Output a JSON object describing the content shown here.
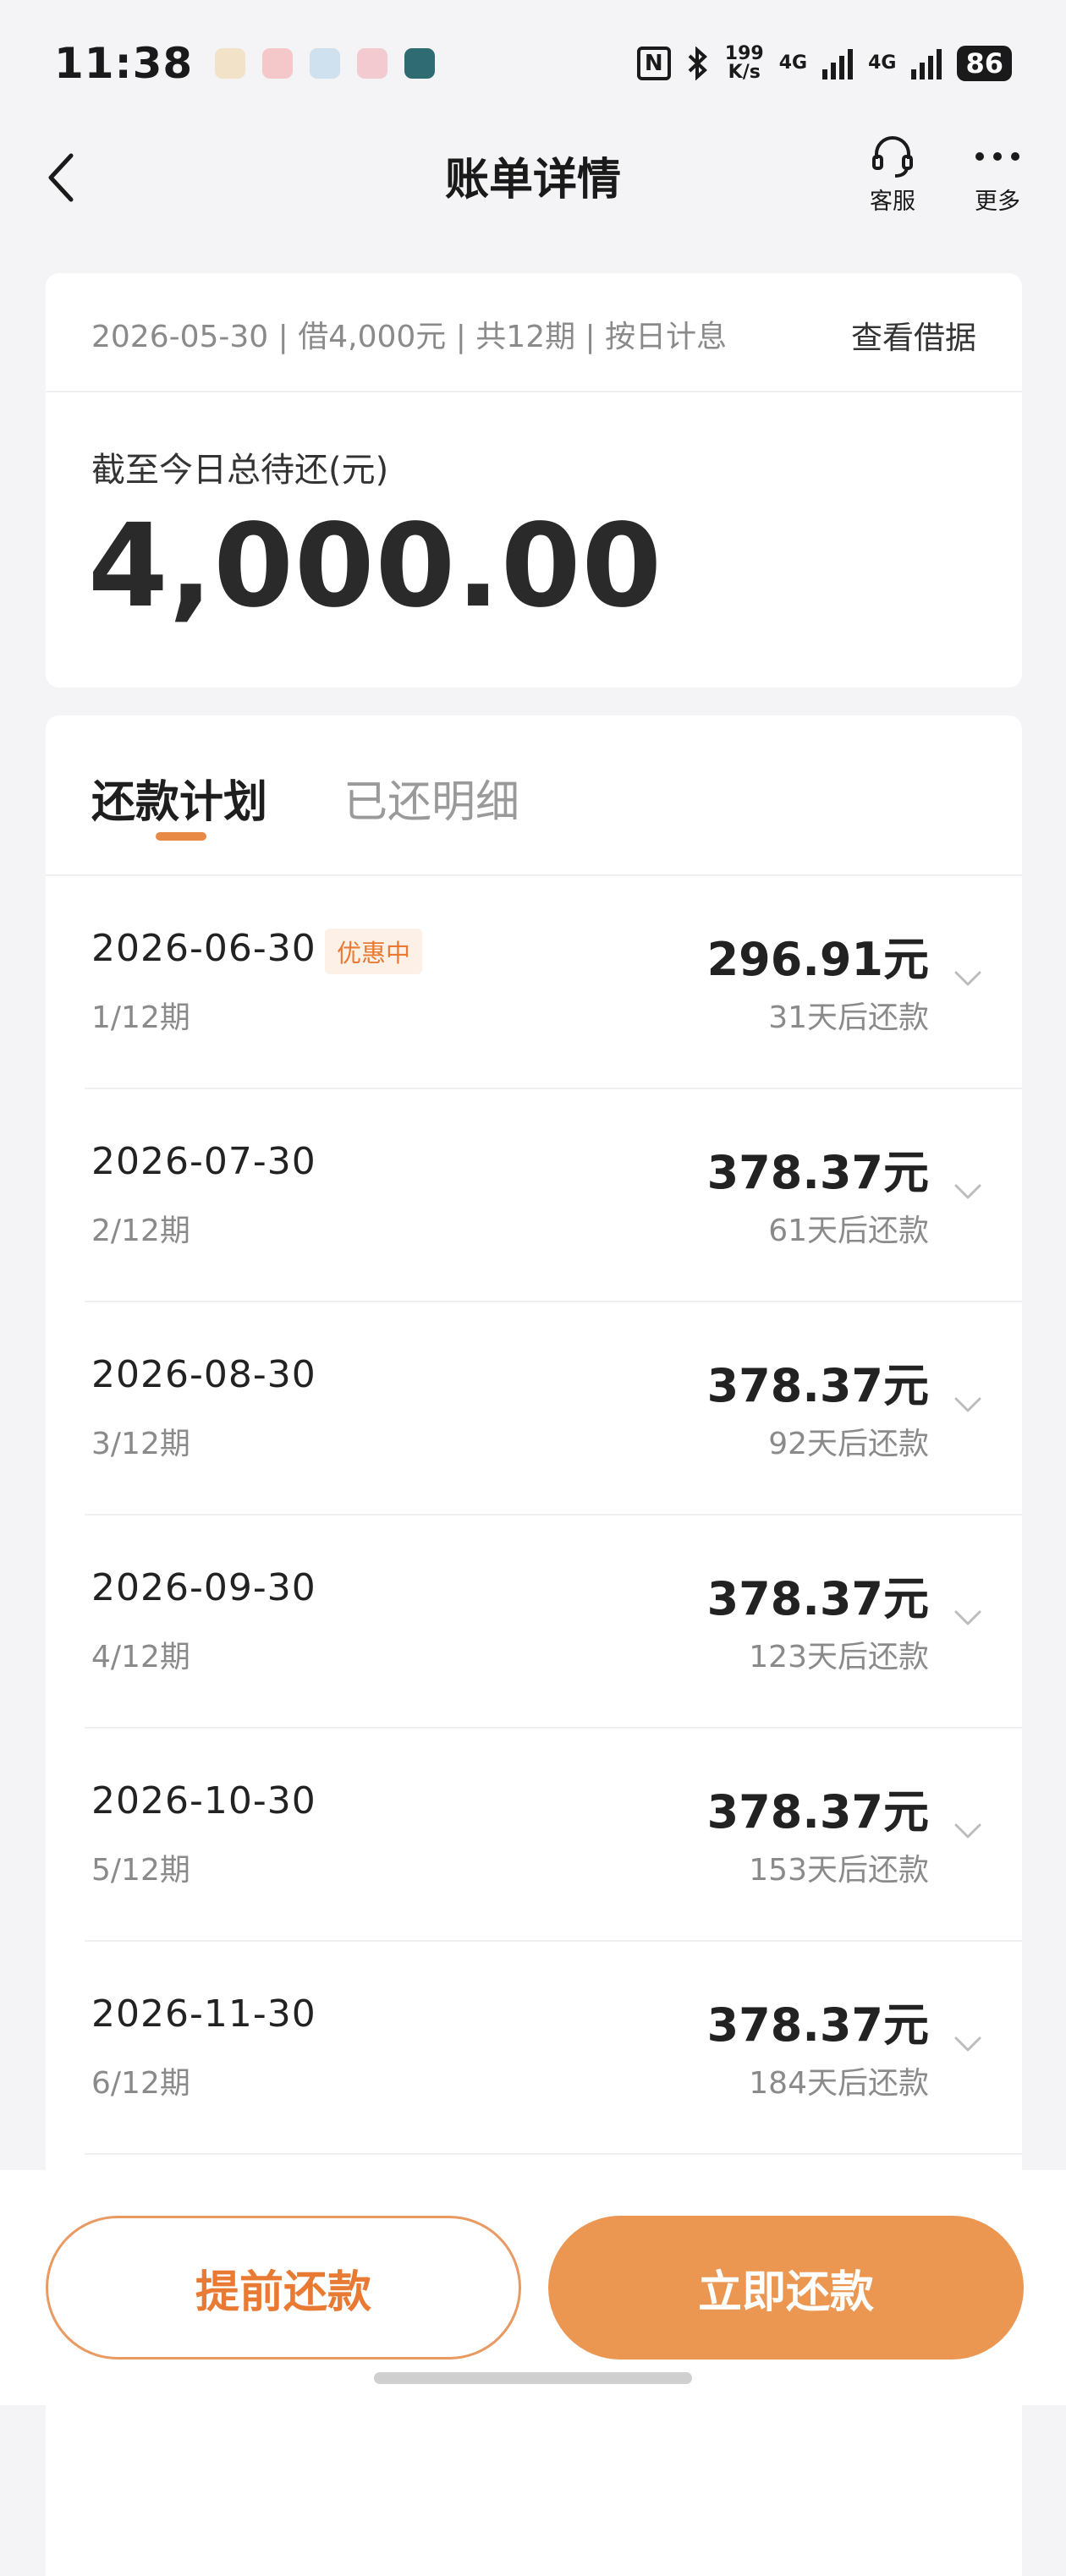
{
  "status_bar": {
    "time": "11:38",
    "speed_top": "199",
    "speed_bottom": "K/s",
    "net1": "4G",
    "net2": "4G",
    "battery": "86",
    "icons": [
      "nfc-icon",
      "bluetooth-icon",
      "signal-icon",
      "battery-icon"
    ]
  },
  "header": {
    "title": "账单详情",
    "service_label": "客服",
    "more_label": "更多"
  },
  "summary": {
    "loan_meta": "2026-05-30 | 借4,000元 | 共12期 | 按日计息",
    "view_note": "查看借据",
    "total_label": "截至今日总待还(元)",
    "total_amount": "4,000.00"
  },
  "tabs": {
    "plan": "还款计划",
    "paid": "已还明细"
  },
  "installments": [
    {
      "date": "2026-06-30",
      "period": "1/12期",
      "badge": "优惠中",
      "amount": "296.91元",
      "days": "31天后还款"
    },
    {
      "date": "2026-07-30",
      "period": "2/12期",
      "amount": "378.37元",
      "days": "61天后还款"
    },
    {
      "date": "2026-08-30",
      "period": "3/12期",
      "amount": "378.37元",
      "days": "92天后还款"
    },
    {
      "date": "2026-09-30",
      "period": "4/12期",
      "amount": "378.37元",
      "days": "123天后还款"
    },
    {
      "date": "2026-10-30",
      "period": "5/12期",
      "amount": "378.37元",
      "days": "153天后还款"
    },
    {
      "date": "2026-11-30",
      "period": "6/12期",
      "amount": "378.37元",
      "days": "184天后还款"
    }
  ],
  "actions": {
    "early_repay": "提前还款",
    "pay_now": "立即还款"
  },
  "colors": {
    "accent": "#eb9752",
    "accent_text": "#e87a33",
    "badge_bg": "#fdf0e6"
  }
}
